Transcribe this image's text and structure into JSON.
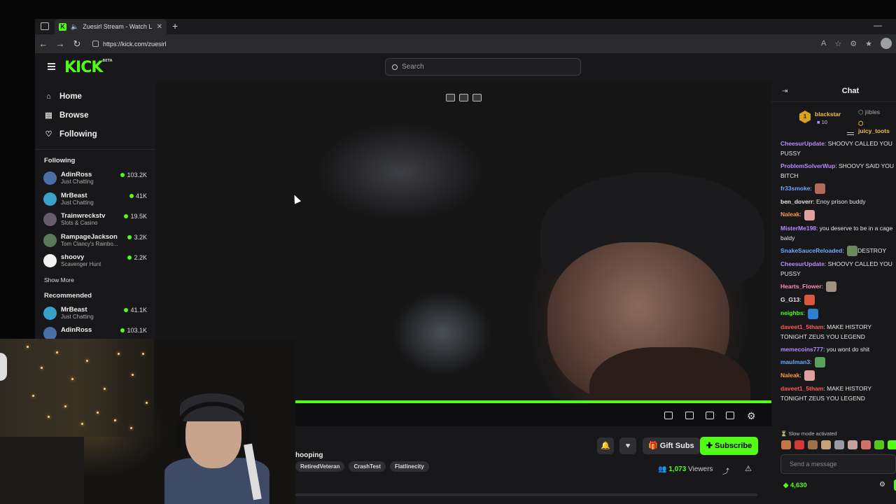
{
  "browser": {
    "tab_title": "Zuesirl Stream - Watch Live ...",
    "tab_favicon_letter": "K",
    "url": "https://kick.com/zuesirl"
  },
  "header": {
    "logo": "KICK",
    "logo_badge": "BETA",
    "search_placeholder": "Search"
  },
  "sidebar": {
    "nav": [
      {
        "label": "Home",
        "icon": "home-icon"
      },
      {
        "label": "Browse",
        "icon": "browse-icon"
      },
      {
        "label": "Following",
        "icon": "heart-icon"
      }
    ],
    "following_title": "Following",
    "following": [
      {
        "name": "AdinRoss",
        "category": "Just Chatting",
        "viewers": "103.2K",
        "color": "#4a6fa5"
      },
      {
        "name": "MrBeast",
        "category": "Just Chatting",
        "viewers": "41K",
        "color": "#39a0c9"
      },
      {
        "name": "Trainwreckstv",
        "category": "Slots & Casino",
        "viewers": "19.5K",
        "color": "#6a5a6e"
      },
      {
        "name": "RampageJackson",
        "category": "Tom Clancy's Rainbo...",
        "viewers": "3.2K",
        "color": "#5a7a5a"
      },
      {
        "name": "shoovy",
        "category": "Scavenger Hunt",
        "viewers": "2.2K",
        "color": "#f2f2f2"
      }
    ],
    "show_more": "Show More",
    "recommended_title": "Recommended",
    "recommended": [
      {
        "name": "MrBeast",
        "category": "Just Chatting",
        "viewers": "41.1K",
        "color": "#39a0c9"
      },
      {
        "name": "AdinRoss",
        "category": "",
        "viewers": "103.1K",
        "color": "#4a6fa5"
      }
    ]
  },
  "stream": {
    "title_fragment": "hooping",
    "tags": [
      "RetiredVeteran",
      "CrashTest",
      "Flatlinecity"
    ],
    "gift_subs": "Gift Subs",
    "subscribe": "Subscribe",
    "viewers_count": "1,073",
    "viewers_label": "Viewers"
  },
  "chat": {
    "title": "Chat",
    "pinned": {
      "top_name": "blackstar",
      "top_rank": "1",
      "top_sub": "10",
      "second_name": "jiibles",
      "third_name": "juicy_toots"
    },
    "messages": [
      {
        "user": "CheesurUpdate",
        "text": "SHOOVY CALLED YOU PUSSY",
        "color": "#b98aff",
        "emote": ""
      },
      {
        "user": "ProblemSolverWup",
        "text": "SHOOVY SAID YOU BITCH",
        "color": "#b98aff",
        "emote": ""
      },
      {
        "user": "fr33smoke",
        "text": "",
        "color": "#6fa8ff",
        "emote": "#b4695a"
      },
      {
        "user": "ben_doverr",
        "text": "Enoy prison buddy",
        "color": "#e6e6e6",
        "emote": ""
      },
      {
        "user": "Naleak",
        "text": "",
        "color": "#ff9a3c",
        "emote": "#e0a0a0"
      },
      {
        "user": "MisterMe198",
        "text": "you deserve to be in a cage baldy",
        "color": "#b98aff",
        "emote": ""
      },
      {
        "user": "SnakeSauceReloaded",
        "text": "DESTROY",
        "color": "#6fa8ff",
        "emote": "#6a8a5a"
      },
      {
        "user": "CheesurUpdate",
        "text": "SHOOVY CALLED YOU PUSSY",
        "color": "#b98aff",
        "emote": ""
      },
      {
        "user": "Hearts_Flower",
        "text": "",
        "color": "#ff8ab5",
        "emote": "#a09080"
      },
      {
        "user": "G_G13",
        "text": "",
        "color": "#e6e6e6",
        "emote": "#d85a3a"
      },
      {
        "user": "neighbs",
        "text": "",
        "color": "#53fc18",
        "emote": "#2e7fd0"
      },
      {
        "user": "daveet1_5tham",
        "text": "MAKE HISTORY TONIGHT ZEUS YOU LEGEND",
        "color": "#ff5a5a",
        "emote": ""
      },
      {
        "user": "memecoins777",
        "text": "you wont do shit",
        "color": "#b98aff",
        "emote": ""
      },
      {
        "user": "maulman3",
        "text": "",
        "color": "#6fa8ff",
        "emote": "#5aa05a"
      },
      {
        "user": "Naleak",
        "text": "",
        "color": "#ff9a3c",
        "emote": "#e0a0a0"
      },
      {
        "user": "daveet1_5tham",
        "text": "MAKE HISTORY TONIGHT ZEUS YOU LEGEND",
        "color": "#ff5a5a",
        "emote": ""
      }
    ],
    "slow_mode": "Slow mode activated",
    "input_placeholder": "Send a message",
    "kicks_count": "4,630"
  }
}
